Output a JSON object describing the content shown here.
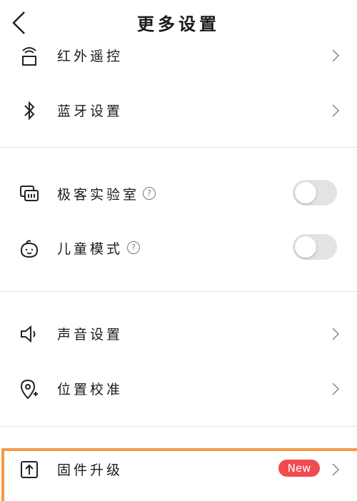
{
  "header": {
    "title": "更多设置"
  },
  "groups": {
    "remote": {
      "label": "红外遥控"
    },
    "bluetooth": {
      "label": "蓝牙设置"
    },
    "geek_lab": {
      "label": "极客实验室",
      "help": "?",
      "enabled": false
    },
    "kids_mode": {
      "label": "儿童模式",
      "help": "?",
      "enabled": false
    },
    "sound": {
      "label": "声音设置"
    },
    "location": {
      "label": "位置校准"
    },
    "firmware": {
      "label": "固件升级",
      "badge": "New"
    }
  },
  "colors": {
    "badge": "#ee4c50",
    "highlight": "#f39a4a",
    "toggle_off": "#e3e3e3"
  }
}
